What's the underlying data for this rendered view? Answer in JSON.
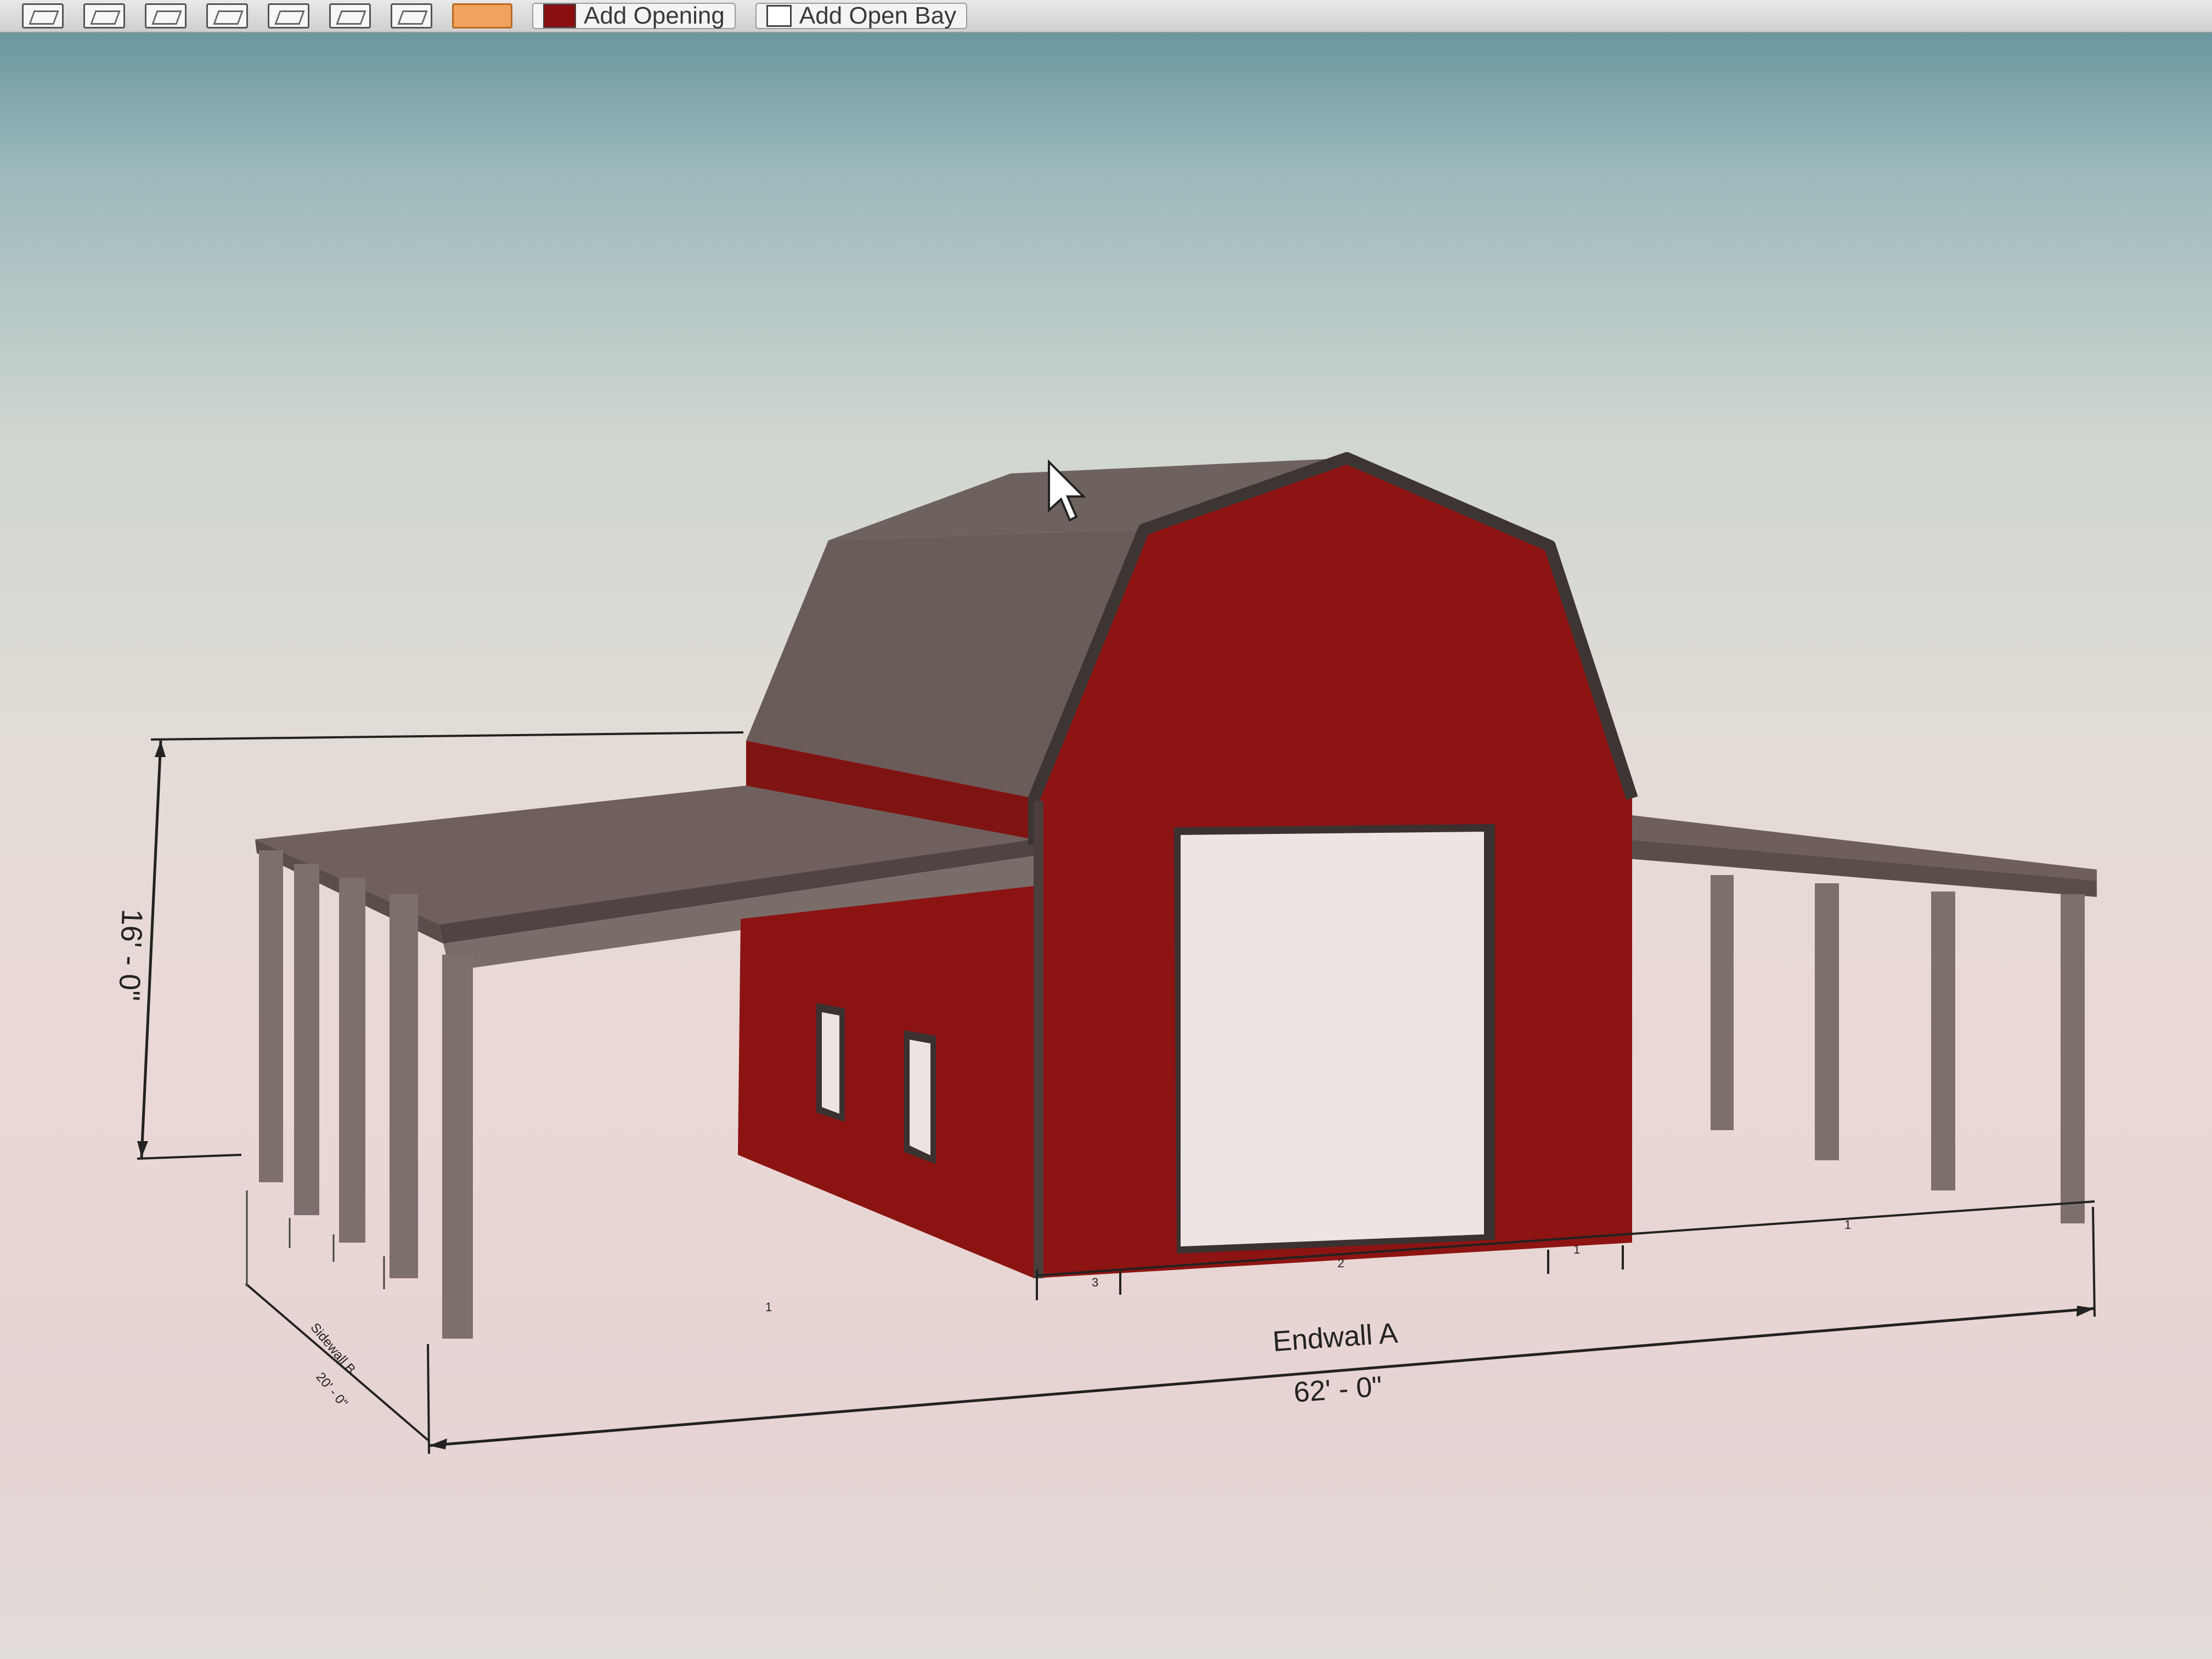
{
  "toolbar": {
    "add_opening_label": "Add Opening",
    "add_open_bay_label": "Add Open Bay",
    "accent_color": "#8a0f10"
  },
  "drawing": {
    "height_dimension": "16' - 0\"",
    "width_dimension": "62' - 0\"",
    "endwall_label": "Endwall A",
    "sidewall_label": "Sidewall B",
    "sidewall_dimension": "20' - 0\"",
    "segment_1": "1",
    "segment_2": "2",
    "segment_3": "3",
    "segment_4": "1",
    "segment_5": "1"
  },
  "colors": {
    "wall_red": "#8b1412",
    "roof_gray": "#6f5f5c",
    "trim_dark": "#3d3533",
    "post_gray": "#7d706c"
  }
}
